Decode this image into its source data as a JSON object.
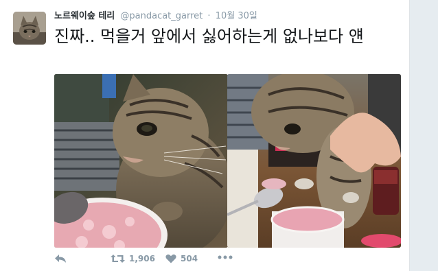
{
  "tweet": {
    "display_name": "노르웨이숲 테리",
    "handle": "@pandacat_garret",
    "separator": "·",
    "timestamp": "10월 30일",
    "text": "진짜.. 먹을거 앞에서 싫어하는게 없나보다 얜",
    "retweet_count": "1,906",
    "like_count": "504"
  },
  "icons": {
    "reply": "reply-icon",
    "retweet": "retweet-icon",
    "like": "heart-icon",
    "more": "more-icon"
  },
  "colors": {
    "action_gray": "#8899a6",
    "text": "#14171a",
    "name": "#292f33"
  }
}
